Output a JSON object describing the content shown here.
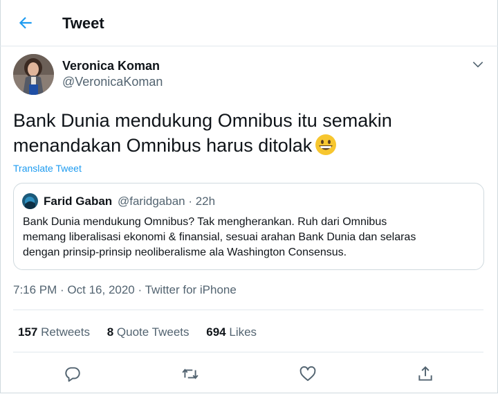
{
  "header": {
    "title": "Tweet"
  },
  "author": {
    "name": "Veronica Koman",
    "handle": "@VeronicaKoman"
  },
  "tweet": {
    "line1": "Bank Dunia mendukung Omnibus itu semakin",
    "line2": "menandakan Omnibus harus ditolak",
    "emoji": "grinning-face-emoji"
  },
  "translate_label": "Translate Tweet",
  "quoted": {
    "name": "Farid Gaban",
    "meta": "@faridgaban · 22h",
    "line1": "Bank Dunia mendukung Omnibus? Tak mengherankan. Ruh dari Omnibus",
    "line2": "memang liberalisasi ekonomi & finansial, sesuai arahan Bank Dunia dan selaras",
    "line3": "dengan prinsip-prinsip neoliberalisme ala Washington Consensus."
  },
  "meta": {
    "time_date": "7:16 PM · Oct 16, 2020 · ",
    "app": "Twitter for iPhone"
  },
  "stats": {
    "retweets_count": "157",
    "retweets_label": "Retweets",
    "quotes_count": "8",
    "quotes_label": "Quote Tweets",
    "likes_count": "694",
    "likes_label": "Likes"
  },
  "colors": {
    "accent": "#1d9bf0",
    "text": "#0f1419",
    "secondary": "#536471",
    "border": "#cfd9de"
  }
}
